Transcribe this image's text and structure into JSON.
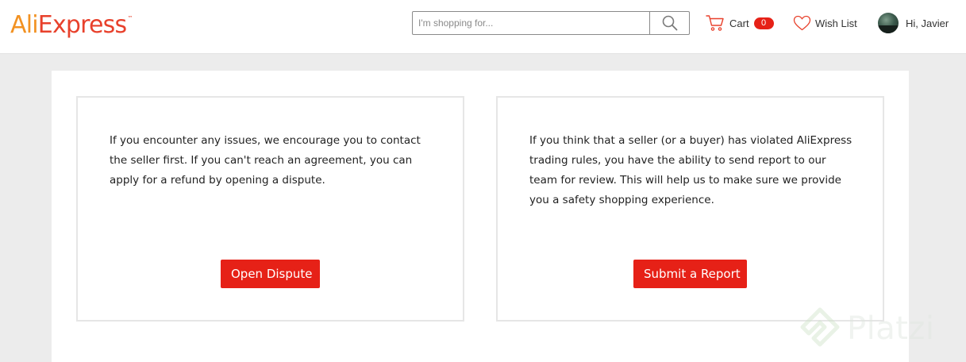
{
  "header": {
    "logo": {
      "part1": "Ali",
      "part2": "Express",
      "mark": "™"
    },
    "search": {
      "placeholder": "I'm shopping for...",
      "value": "",
      "icon": "search-icon"
    },
    "cart": {
      "label": "Cart",
      "count": "0",
      "icon": "cart-icon"
    },
    "wishlist": {
      "label": "Wish List",
      "icon": "heart-icon"
    },
    "user": {
      "greeting": "Hi, Javier"
    }
  },
  "cards": {
    "dispute": {
      "text": "If you encounter any issues, we encourage you to contact the seller first. If you can't reach an agreement, you can apply for a refund by opening a dispute.",
      "button": "Open Dispute"
    },
    "report": {
      "text": "If you think that a seller (or a buyer) has violated AliExpress trading rules, you have the ability to send report to our team for review. This will help us to make sure we provide you a safety shopping experience.",
      "button": "Submit a Report"
    }
  },
  "watermark": {
    "text": "Platzi"
  },
  "colors": {
    "accent_red": "#e62117",
    "logo_orange": "#f29223",
    "logo_red": "#e8412c",
    "page_background": "#ececec"
  }
}
